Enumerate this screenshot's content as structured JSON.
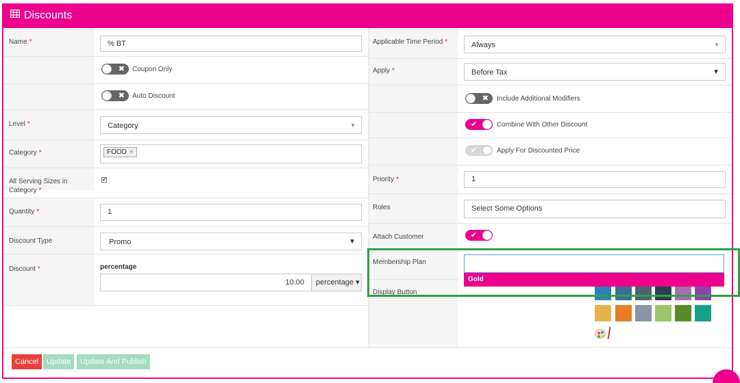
{
  "header": {
    "title": "Discounts",
    "icon": "table-icon"
  },
  "required_mark": "*",
  "left": {
    "name": {
      "label": "Name",
      "value": "% BT"
    },
    "coupon_only": {
      "label": "Coupon Only",
      "state": "off"
    },
    "auto_discount": {
      "label": "Auto Discount",
      "state": "off"
    },
    "level": {
      "label": "Level",
      "value": "Category"
    },
    "category": {
      "label": "Category",
      "tag": "FOOD",
      "tag_remove": "×"
    },
    "all_serving_sizes": {
      "label": "All Serving Sizes in Category",
      "checked": true,
      "check_mark": "✔"
    },
    "quantity": {
      "label": "Quantity",
      "value": "1"
    },
    "discount_type": {
      "label": "Discount Type",
      "value": "Promo"
    },
    "discount": {
      "label": "Discount",
      "sub_label": "percentage",
      "value": "10.00",
      "unit": "percentage ▾"
    }
  },
  "right": {
    "time_period": {
      "label": "Applicable Time Period",
      "value": "Always"
    },
    "apply": {
      "label": "Apply",
      "value": "Before Tax"
    },
    "include_modifiers": {
      "label": "Include Additional Modifiers",
      "state": "off"
    },
    "combine": {
      "label": "Combine With Other Discount",
      "state": "on"
    },
    "discounted_price": {
      "label": "Apply For Discounted Price",
      "state": "disabled-on"
    },
    "priority": {
      "label": "Priority",
      "value": "1"
    },
    "roles": {
      "label": "Roles",
      "placeholder": "Select Some Options"
    },
    "attach_customer": {
      "label": "Attach Customer",
      "state": "on"
    },
    "membership_plan": {
      "label": "Membership Plan",
      "value": "",
      "options": [
        "Gold"
      ]
    },
    "display_button": {
      "label": "Display Button"
    }
  },
  "toggle_marks": {
    "off": "✖",
    "on": "✔"
  },
  "colors": {
    "brand": "#ec008c",
    "swatches": [
      "#2a80b9",
      "#3c6e97",
      "#4d6270",
      "#2c3e50",
      "#a76fae",
      "#8e44ad",
      "#e6b34d",
      "#e67e22",
      "#8796a8",
      "#9cc56a",
      "#5a8a2a",
      "#16a085"
    ]
  },
  "buttons": {
    "cancel": "Cancel",
    "update": "Update",
    "publish": "Update And Publish"
  }
}
